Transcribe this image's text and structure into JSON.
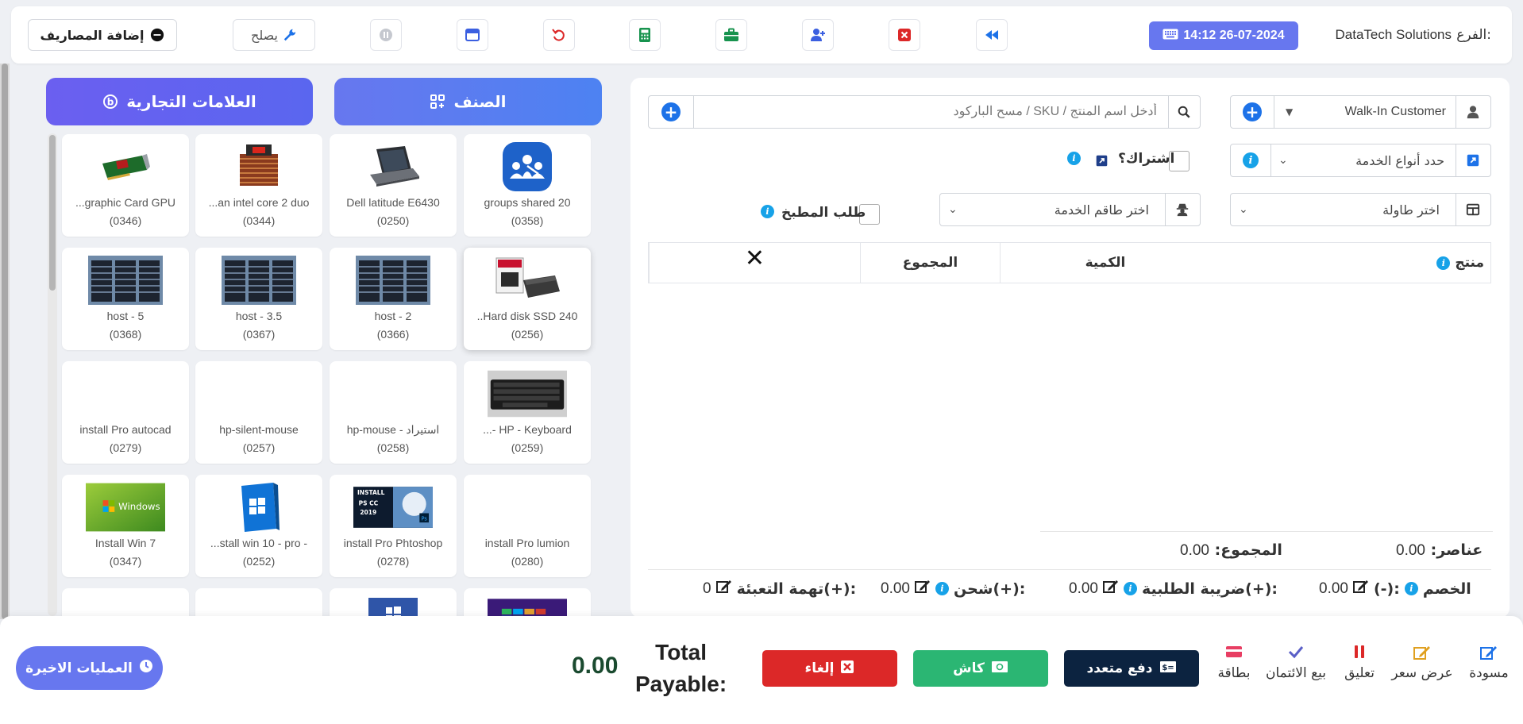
{
  "header": {
    "branch_label": "الفرع:",
    "branch_name": "DataTech Solutions",
    "datetime": "14:12 26-07-2024",
    "fix_label": "يصلح",
    "add_expenses_label": "إضافة المصاريف"
  },
  "left_panel": {
    "category_label": "الصنف",
    "brands_label": "العلامات التجارية",
    "products": [
      {
        "name": "groups shared 20",
        "code": "(0358)"
      },
      {
        "name": "Dell latitude E6430",
        "code": "(0250)"
      },
      {
        "name": "...an intel core 2 duo",
        "code": "(0344)"
      },
      {
        "name": "...graphic Card GPU",
        "code": "(0346)"
      },
      {
        "name": "..Hard disk SSD 240",
        "code": "(0256)"
      },
      {
        "name": "host - 2",
        "code": "(0366)"
      },
      {
        "name": "host - 3.5",
        "code": "(0367)"
      },
      {
        "name": "host - 5",
        "code": "(0368)"
      },
      {
        "name": "...- HP - Keyboard",
        "code": "(0259)"
      },
      {
        "name": "hp-mouse - استيراد",
        "code": "(0258)"
      },
      {
        "name": "hp-silent-mouse",
        "code": "(0257)"
      },
      {
        "name": "install Pro autocad",
        "code": "(0279)"
      },
      {
        "name": "install Pro lumion",
        "code": "(0280)"
      },
      {
        "name": "install Pro Phtoshop",
        "code": "(0278)"
      },
      {
        "name": "...stall win 10 - pro -",
        "code": "(0252)"
      },
      {
        "name": "Install Win 7",
        "code": "(0347)"
      }
    ]
  },
  "form": {
    "customer": "Walk-In Customer",
    "search_placeholder": "أدخل اسم المنتج / SKU / مسح الباركود",
    "service_types": "حدد أنواع الخدمة",
    "subscription_label": "اشتراك؟",
    "table_select": "اختر طاولة",
    "service_staff": "اختر طاقم الخدمة",
    "kitchen_order": "طلب المطبخ"
  },
  "table": {
    "col_product": "منتج",
    "col_qty": "الكمية",
    "col_total": "المجموع",
    "col_remove": "✕"
  },
  "totals": {
    "items_label": "عناصر:",
    "items_value": "0.00",
    "total_label": "المجموع:",
    "total_value": "0.00",
    "discount_label": "الخصم",
    "discount_sign": "(-):",
    "discount_value": "0.00",
    "order_tax_label": "ضريبة الطلبية(+):",
    "order_tax_value": "0.00",
    "shipping_label": "شحن(+):",
    "shipping_value": "0.00",
    "packing_label": "تهمة التعبئة(+):",
    "packing_value": "0"
  },
  "bottom": {
    "draft": "مسودة",
    "quotation": "عرض سعر",
    "suspend": "تعليق",
    "credit_sale": "بيع الائتمان",
    "card": "بطاقة",
    "multi_pay": "دفع متعدد",
    "cash": "كاش",
    "cancel": "إلغاء",
    "total_payable_line1": "Total",
    "total_payable_line2": "Payable:",
    "total_payable_value": "0.00",
    "recent_transactions": "العمليات الاخيرة"
  },
  "colors": {
    "primary": "#6777ef",
    "cash": "#2bb673",
    "cancel": "#dc2828",
    "multi_pay": "#0c2340"
  }
}
